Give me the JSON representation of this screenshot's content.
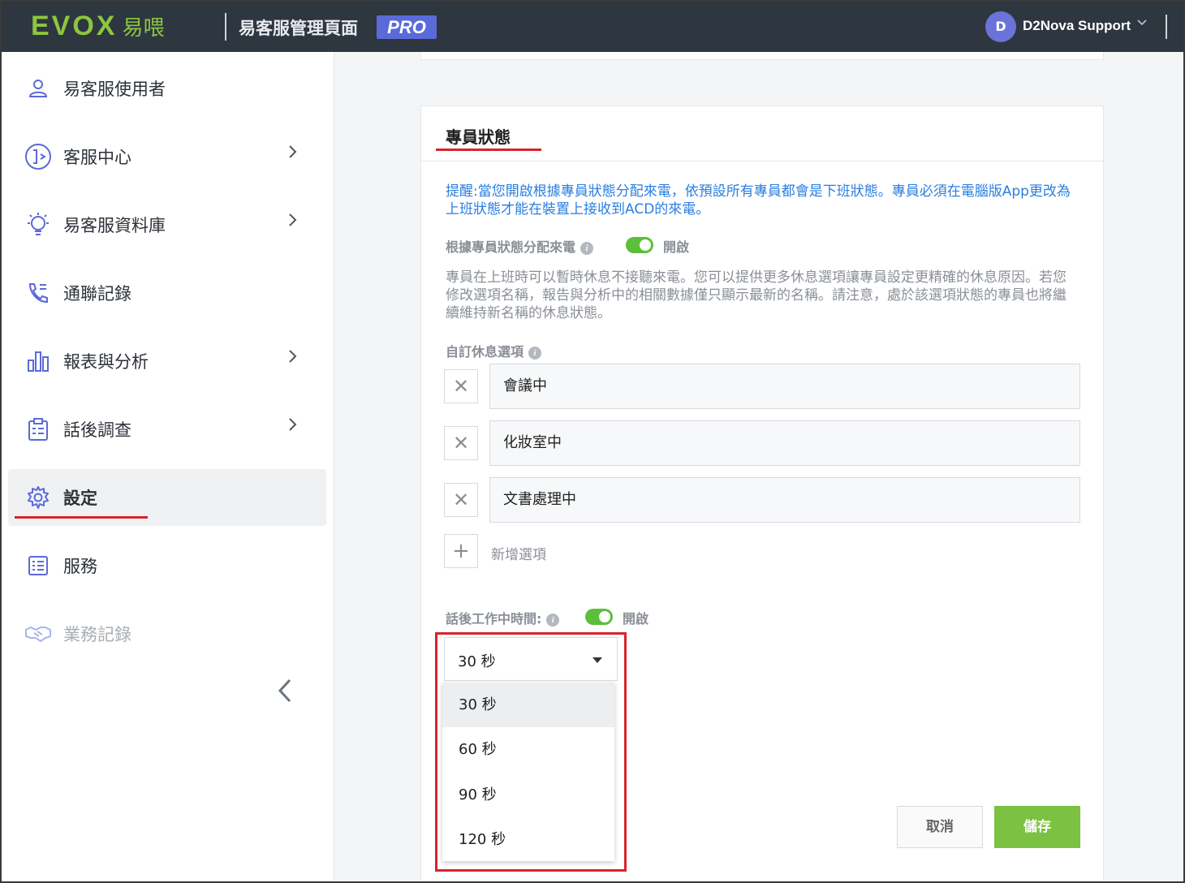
{
  "header": {
    "logo": "EVOX",
    "logo_cn": "易喂",
    "app_title": "易客服管理頁面",
    "pro_badge": "PRO",
    "avatar_letter": "D",
    "user_name": "D2Nova Support"
  },
  "sidebar": {
    "items": [
      {
        "label": "易客服使用者",
        "icon": "user-icon",
        "has_chevron": false
      },
      {
        "label": "客服中心",
        "icon": "call-center-icon",
        "has_chevron": true
      },
      {
        "label": "易客服資料庫",
        "icon": "lightbulb-icon",
        "has_chevron": true
      },
      {
        "label": "通聯記錄",
        "icon": "phone-log-icon",
        "has_chevron": false
      },
      {
        "label": "報表與分析",
        "icon": "bar-chart-icon",
        "has_chevron": true
      },
      {
        "label": "話後調查",
        "icon": "clipboard-icon",
        "has_chevron": true
      },
      {
        "label": "設定",
        "icon": "gear-icon",
        "has_chevron": false,
        "active": true
      },
      {
        "label": "服務",
        "icon": "list-icon",
        "has_chevron": false
      },
      {
        "label": "業務記錄",
        "icon": "handshake-icon",
        "has_chevron": false,
        "disabled": true
      }
    ]
  },
  "card": {
    "title": "專員狀態",
    "hint": "提醒:當您開啟根據專員狀態分配來電，依預設所有專員都會是下班狀態。專員必須在電腦版App更改為上班狀態才能在裝置上接收到ACD的來電。",
    "assign_label": "根據專員狀態分配來電",
    "assign_toggle_label": "開啟",
    "description": "專員在上班時可以暫時休息不接聽來電。您可以提供更多休息選項讓專員設定更精確的休息原因。若您修改選項名稱，報告與分析中的相關數據僅只顯示最新的名稱。請注意，處於該選項狀態的專員也將繼續維持新名稱的休息狀態。",
    "custom_label": "自訂休息選項",
    "options": [
      "會議中",
      "化妝室中",
      "文書處理中"
    ],
    "add_option": "新增選項",
    "acw_label": "話後工作中時間:",
    "acw_toggle_label": "開啟",
    "select_value": "30 秒",
    "dropdown": [
      "30 秒",
      "60 秒",
      "90 秒",
      "120 秒"
    ],
    "cancel": "取消",
    "save": "儲存"
  },
  "colors": {
    "topbar": "#2e3640",
    "brand_green": "#8cc63f",
    "toggle_on": "#5cbf3b",
    "save_button": "#7cc242",
    "hint_blue": "#2a7ee0",
    "annotation_red": "#d9232b"
  }
}
